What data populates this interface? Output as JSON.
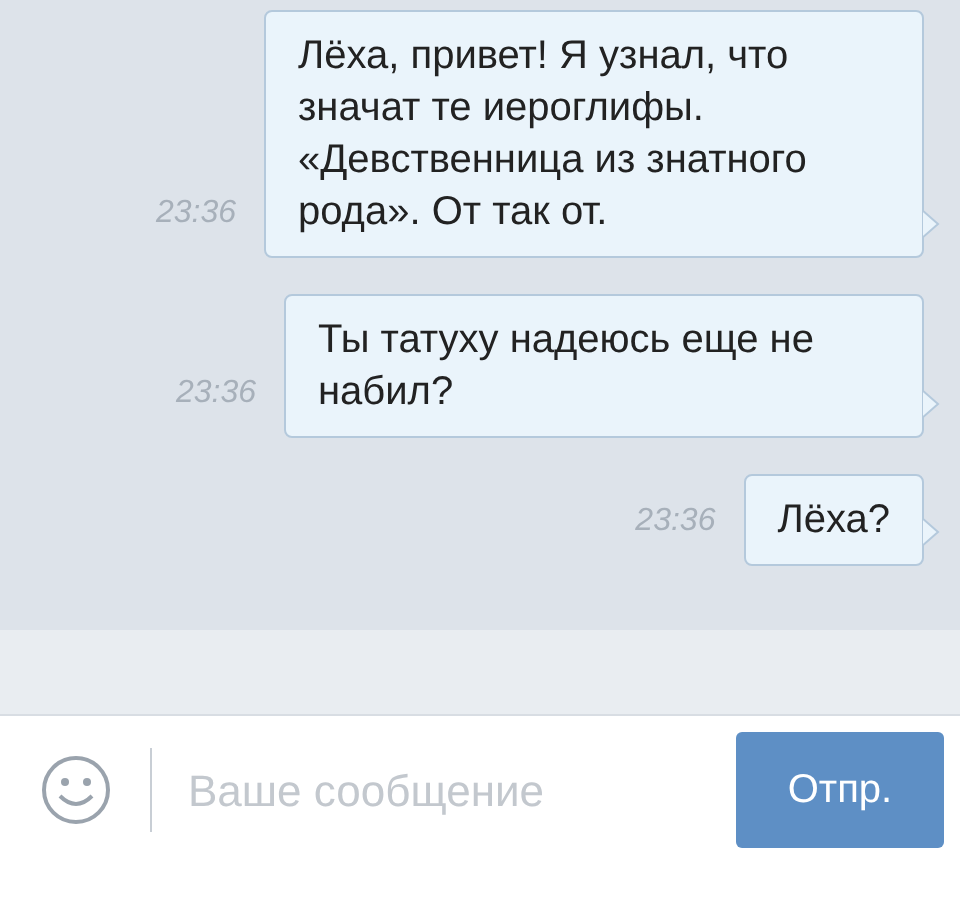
{
  "messages": [
    {
      "text": "Лёха, привет! Я узнал, что значат те иероглифы. «Девственница из знатного рода». От так от.",
      "time": "23:36"
    },
    {
      "text": "Ты татуху надеюсь еще не набил?",
      "time": "23:36"
    },
    {
      "text": "Лёха?",
      "time": "23:36"
    }
  ],
  "composer": {
    "placeholder": "Ваше сообщение",
    "send_button": "Отпр."
  }
}
